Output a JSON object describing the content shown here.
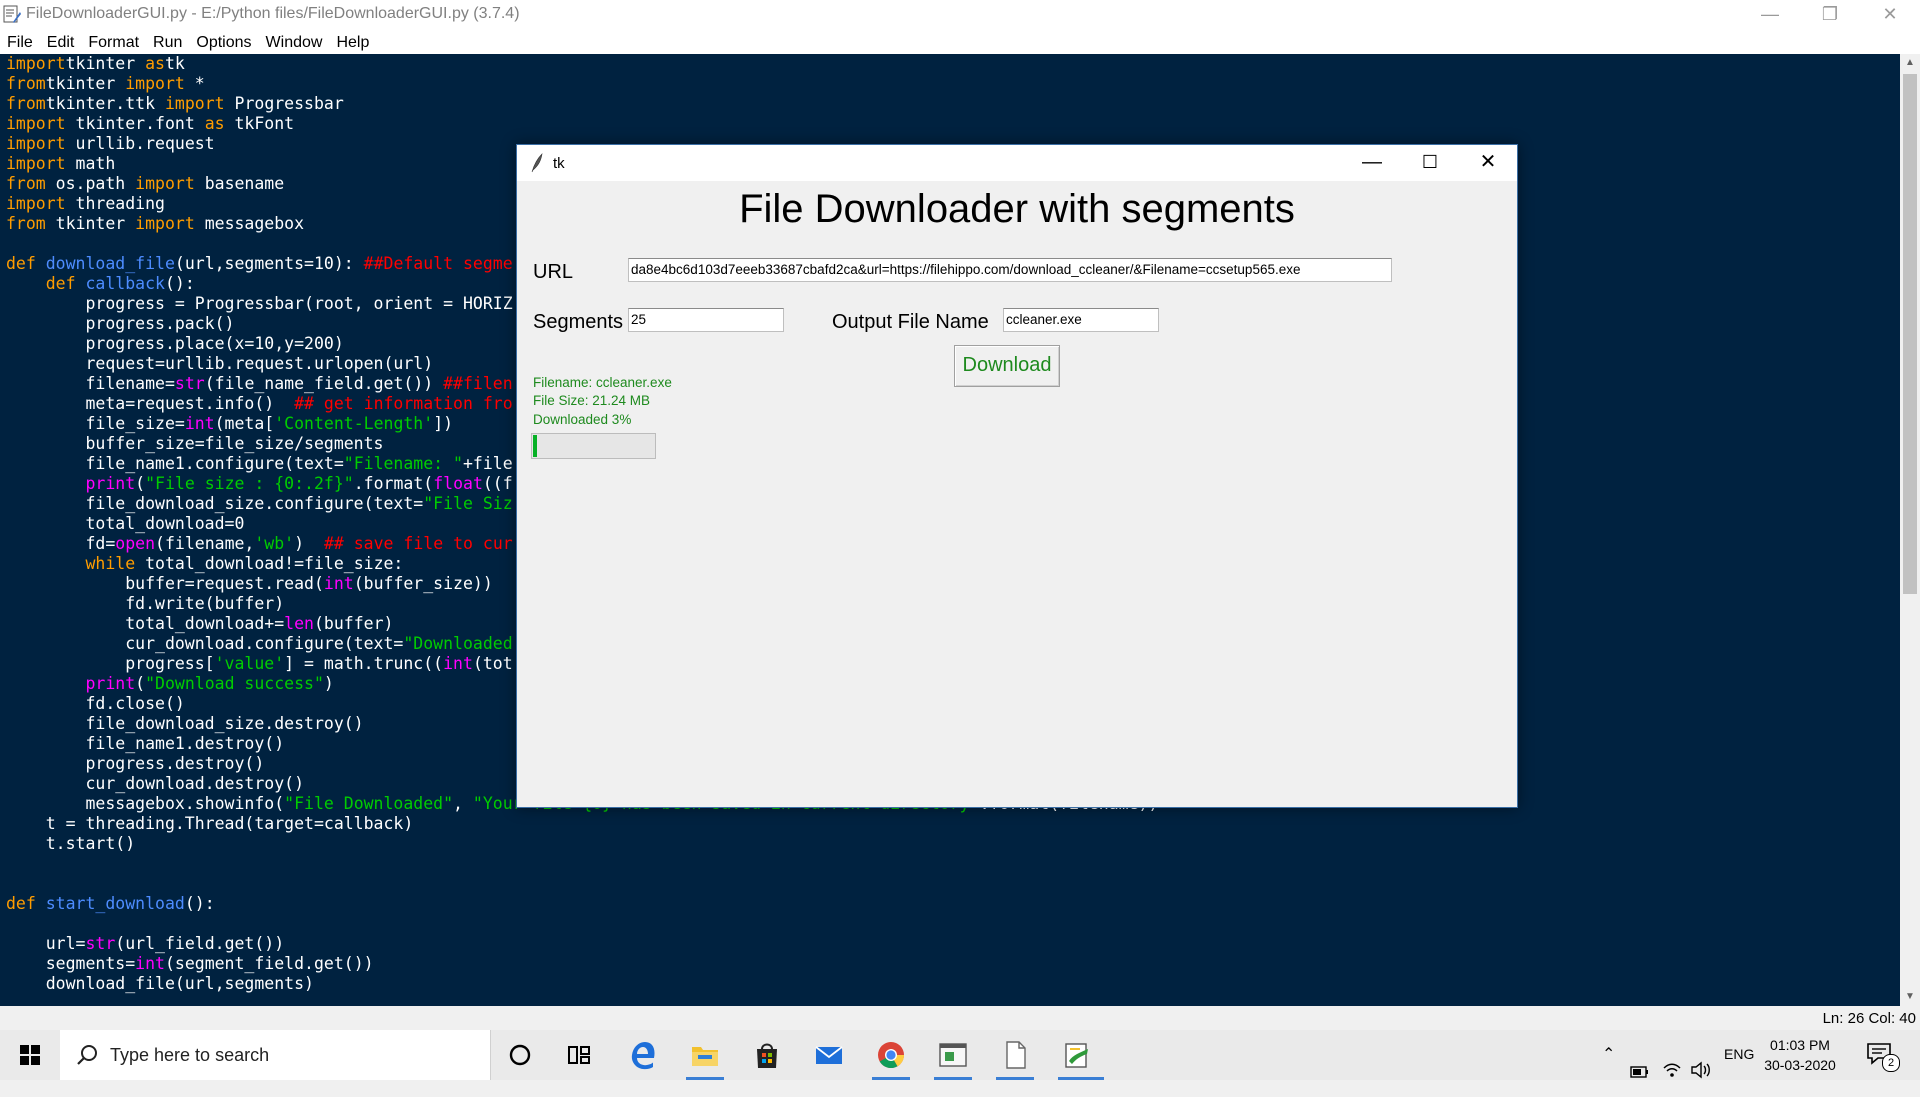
{
  "idle": {
    "title": "FileDownloaderGUI.py - E:/Python files/FileDownloaderGUI.py (3.7.4)",
    "menu": [
      "File",
      "Edit",
      "Format",
      "Run",
      "Options",
      "Window",
      "Help"
    ],
    "code_lines": [
      [
        [
          "kw",
          "import"
        ],
        [
          "",
          "tkinter "
        ],
        [
          "kw",
          "as"
        ],
        [
          "",
          "tk"
        ]
      ],
      [
        [
          "kw",
          "from"
        ],
        [
          "",
          "tkinter "
        ],
        [
          "kw",
          "import"
        ],
        [
          "",
          " *"
        ]
      ],
      [
        [
          "kw",
          "from"
        ],
        [
          "",
          "tkinter.ttk "
        ],
        [
          "kw",
          "import"
        ],
        [
          "",
          " Progressbar"
        ]
      ],
      [
        [
          "kw",
          "import"
        ],
        [
          "",
          " tkinter.font "
        ],
        [
          "kw",
          "as"
        ],
        [
          "",
          " tkFont"
        ]
      ],
      [
        [
          "kw",
          "import"
        ],
        [
          "",
          " urllib.request"
        ]
      ],
      [
        [
          "kw",
          "import"
        ],
        [
          "",
          " math"
        ]
      ],
      [
        [
          "kw",
          "from"
        ],
        [
          "",
          " os.path "
        ],
        [
          "kw",
          "import"
        ],
        [
          "",
          " basename"
        ]
      ],
      [
        [
          "kw",
          "import"
        ],
        [
          "",
          " threading"
        ]
      ],
      [
        [
          "kw",
          "from"
        ],
        [
          "",
          " tkinter "
        ],
        [
          "kw",
          "import"
        ],
        [
          "",
          " messagebox"
        ]
      ],
      [],
      [
        [
          "kw",
          "def"
        ],
        [
          "fn",
          " download_file"
        ],
        [
          "",
          "(url,segments=10): "
        ],
        [
          "cm",
          "##Default segme"
        ]
      ],
      [
        [
          "",
          "    "
        ],
        [
          "kw",
          "def"
        ],
        [
          "fn",
          " callback"
        ],
        [
          "",
          "():"
        ]
      ],
      [
        [
          "",
          "        progress = Progressbar(root, orient = HORIZ"
        ]
      ],
      [
        [
          "",
          "        progress.pack()"
        ]
      ],
      [
        [
          "",
          "        progress.place(x=10,y=200)"
        ]
      ],
      [
        [
          "",
          "        request=urllib.request.urlopen(url)"
        ]
      ],
      [
        [
          "",
          "        filename="
        ],
        [
          "bi",
          "str"
        ],
        [
          "",
          "(file_name_field.get()) "
        ],
        [
          "cm",
          "##filen"
        ]
      ],
      [
        [
          "",
          "        meta=request.info()  "
        ],
        [
          "cm",
          "## get information fro"
        ]
      ],
      [
        [
          "",
          "        file_size="
        ],
        [
          "bi",
          "int"
        ],
        [
          "",
          "(meta["
        ],
        [
          "st",
          "'Content-Length'"
        ],
        [
          "",
          "])"
        ]
      ],
      [
        [
          "",
          "        buffer_size=file_size/segments"
        ]
      ],
      [
        [
          "",
          "        file_name1.configure(text="
        ],
        [
          "st",
          "\"Filename: \""
        ],
        [
          "",
          "+file"
        ]
      ],
      [
        [
          "",
          "        "
        ],
        [
          "bi",
          "print"
        ],
        [
          "",
          "("
        ],
        [
          "st",
          "\"File size : {0:.2f}\""
        ],
        [
          "",
          ".format("
        ],
        [
          "bi",
          "float"
        ],
        [
          "",
          "((f"
        ]
      ],
      [
        [
          "",
          "        file_download_size.configure(text="
        ],
        [
          "st",
          "\"File Siz"
        ]
      ],
      [
        [
          "",
          "        total_download=0"
        ]
      ],
      [
        [
          "",
          "        fd="
        ],
        [
          "bi",
          "open"
        ],
        [
          "",
          "(filename,"
        ],
        [
          "st",
          "'wb'"
        ],
        [
          "",
          ")  "
        ],
        [
          "cm",
          "## save file to cur"
        ]
      ],
      [
        [
          "",
          "        "
        ],
        [
          "kw",
          "while"
        ],
        [
          "",
          " total_download!=file_size:"
        ]
      ],
      [
        [
          "",
          "            buffer=request.read("
        ],
        [
          "bi",
          "int"
        ],
        [
          "",
          "(buffer_size))"
        ]
      ],
      [
        [
          "",
          "            fd.write(buffer)"
        ]
      ],
      [
        [
          "",
          "            total_download+="
        ],
        [
          "bi",
          "len"
        ],
        [
          "",
          "(buffer)"
        ]
      ],
      [
        [
          "",
          "            cur_download.configure(text="
        ],
        [
          "st",
          "\"Downloaded"
        ]
      ],
      [
        [
          "",
          "            progress["
        ],
        [
          "st",
          "'value'"
        ],
        [
          "",
          "] = math.trunc(("
        ],
        [
          "bi",
          "int"
        ],
        [
          "",
          "(tot"
        ]
      ],
      [
        [
          "",
          "        "
        ],
        [
          "bi",
          "print"
        ],
        [
          "",
          "("
        ],
        [
          "st",
          "\"Download success\""
        ],
        [
          "",
          ")"
        ]
      ],
      [
        [
          "",
          "        fd.close()"
        ]
      ],
      [
        [
          "",
          "        file_download_size.destroy()"
        ]
      ],
      [
        [
          "",
          "        file_name1.destroy()"
        ]
      ],
      [
        [
          "",
          "        progress.destroy()"
        ]
      ],
      [
        [
          "",
          "        cur_download.destroy()"
        ]
      ],
      [
        [
          "",
          "        messagebox.showinfo("
        ],
        [
          "st",
          "\"File Downloaded\""
        ],
        [
          "",
          ", "
        ],
        [
          "st",
          "\"Your file {0} has been saved in current directory\""
        ],
        [
          "",
          ".format(filename))"
        ]
      ],
      [
        [
          "",
          "    t = threading.Thread(target=callback)"
        ]
      ],
      [
        [
          "",
          "    t.start()"
        ]
      ],
      [],
      [],
      [
        [
          "kw",
          "def"
        ],
        [
          "fn",
          " start_download"
        ],
        [
          "",
          "():"
        ]
      ],
      [],
      [
        [
          "",
          "    url="
        ],
        [
          "bi",
          "str"
        ],
        [
          "",
          "(url_field.get())"
        ]
      ],
      [
        [
          "",
          "    segments="
        ],
        [
          "bi",
          "int"
        ],
        [
          "",
          "(segment_field.get())"
        ]
      ],
      [
        [
          "",
          "    download_file(url,segments)"
        ]
      ]
    ],
    "status": "Ln: 26  Col: 40"
  },
  "tk": {
    "title": "tk",
    "heading": "File Downloader with segments",
    "url_label": "URL",
    "url_value": "da8e4bc6d103d7eeeb33687cbafd2ca&url=https://filehippo.com/download_ccleaner/&Filename=ccsetup565.exe",
    "segments_label": "Segments",
    "segments_value": "25",
    "output_label": "Output File Name",
    "output_value": "ccleaner.exe",
    "download_button": "Download",
    "filename_status": "Filename: ccleaner.exe",
    "filesize_status": "File Size: 21.24 MB",
    "downloaded_status": "Downloaded 3%",
    "progress_fraction": 0.03
  },
  "taskbar": {
    "search_placeholder": "Type here to search",
    "language": "ENG",
    "time": "01:03 PM",
    "date": "30-03-2020",
    "notification_count": "2"
  },
  "colors": {
    "editor_bg": "#002240",
    "keyword": "#ff9d00",
    "builtin": "#ff00ff",
    "string": "#00cc00",
    "comment": "#ff0000",
    "defname": "#4d8cff",
    "status_green": "#1e8a1e",
    "progress_green": "#06b025"
  }
}
